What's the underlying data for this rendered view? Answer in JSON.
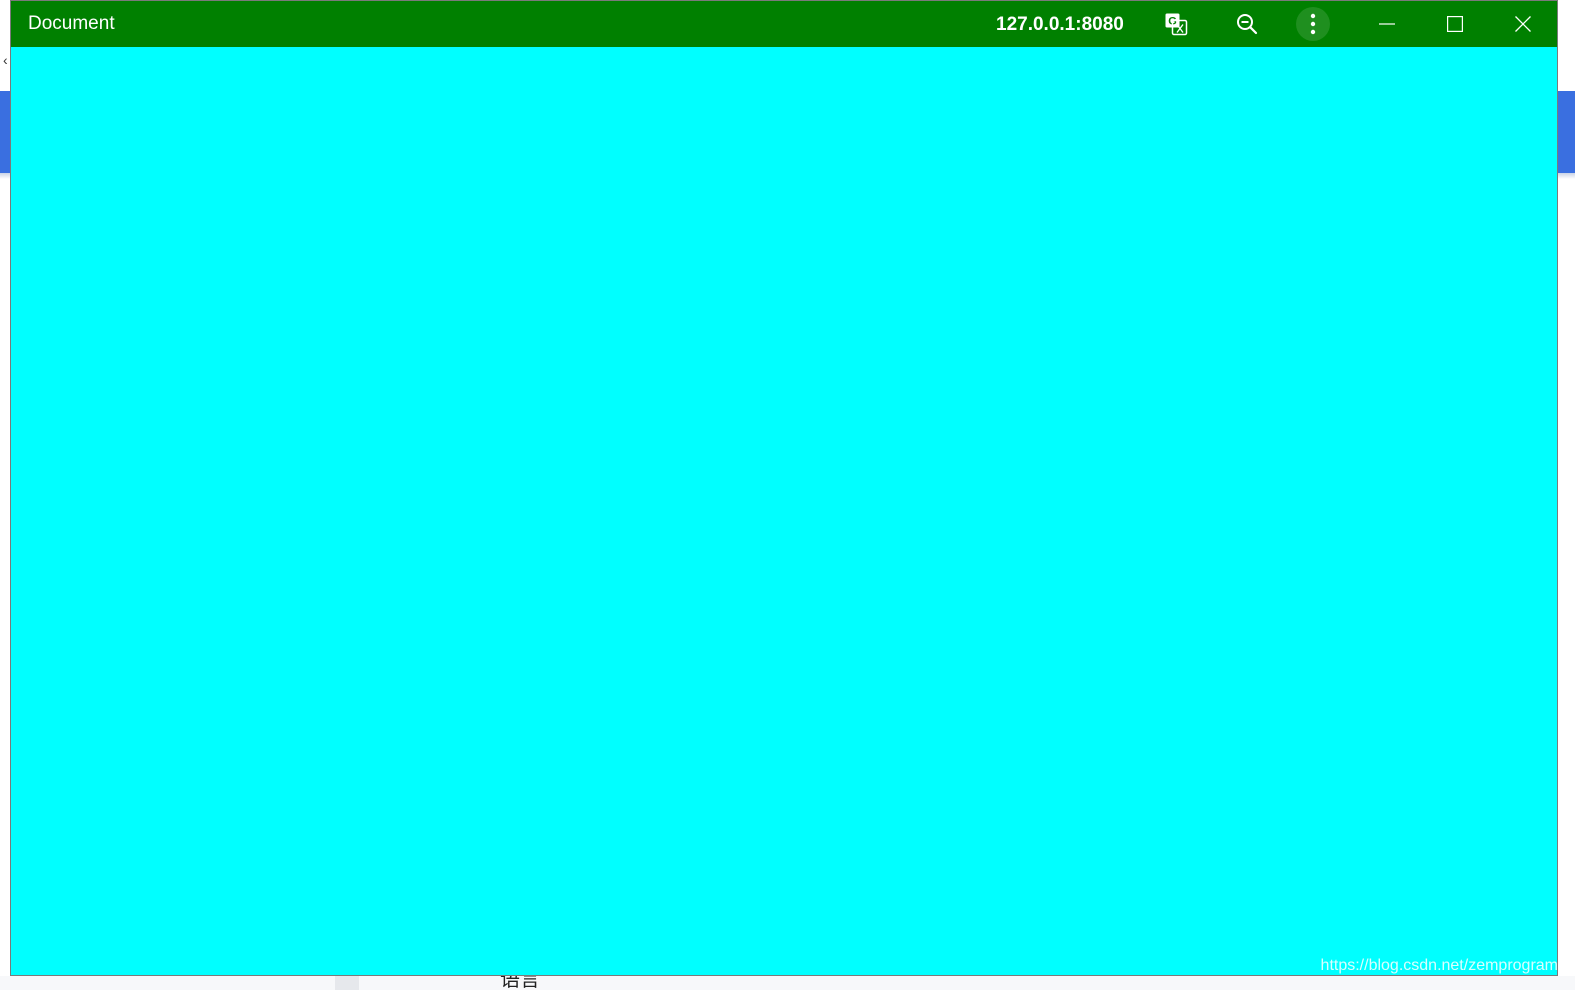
{
  "window": {
    "title": "Document",
    "origin": "127.0.0.1:8080",
    "titlebar_color": "#008000",
    "content_color": "#00ffff"
  },
  "titlebar_buttons": {
    "translate_icon": "translate-icon",
    "zoom_icon": "zoom-out-icon",
    "menu_icon": "more-vertical-icon",
    "minimize_icon": "minimize-icon",
    "maximize_icon": "maximize-icon",
    "close_icon": "close-icon"
  },
  "background": {
    "accent_color": "#3a6fe0",
    "back_glyph": "‹",
    "bottom_text": "语言"
  },
  "watermark": "https://blog.csdn.net/zemprogram"
}
